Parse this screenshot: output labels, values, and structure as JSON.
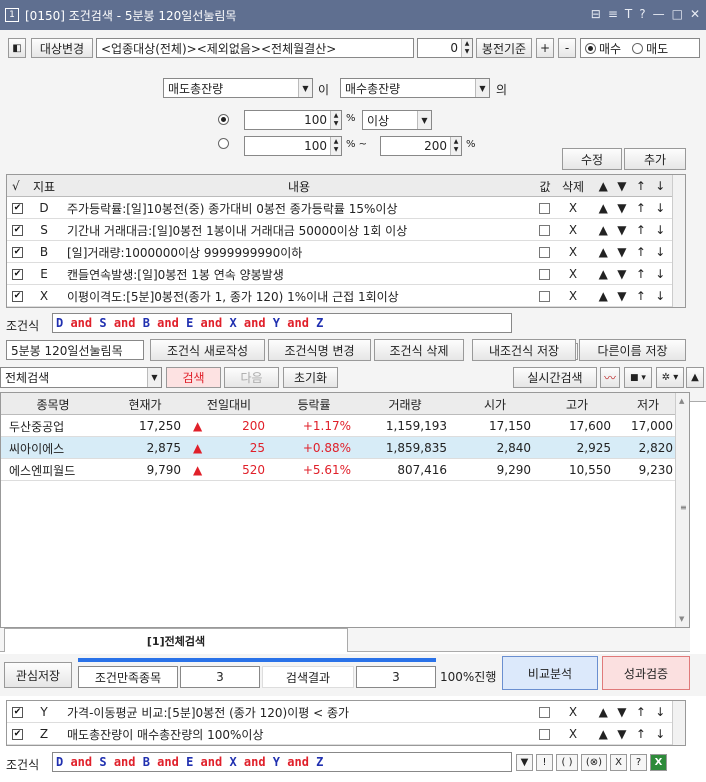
{
  "window": {
    "number": "1",
    "title": "[0150] 조건검색 - 5분봉 120일선눌림목",
    "controls": [
      "⊟",
      "≡",
      "T",
      "?",
      "—",
      "□",
      "✕"
    ]
  },
  "target": {
    "label": "대상변경",
    "value": "<업종대상(전체)><제외없음><전체월결산>",
    "bong_count": "0",
    "bong_label": "봉전기준",
    "plus": "+",
    "minus": "-",
    "buy_label": "매수",
    "sell_label": "매도"
  },
  "editor": {
    "left_select": "매도총잔량",
    "i_label": "이",
    "right_select": "매수총잔량",
    "ui_label": "의",
    "value1": "100",
    "pct1": "%",
    "cond1": "이상",
    "value2_from": "100",
    "pct2": "% ~",
    "value2_to": "200",
    "pct3": "%",
    "edit_button": "수정",
    "add_button": "추가"
  },
  "condition_table": {
    "headers": {
      "check": "√",
      "index": "지표",
      "content": "내용",
      "value": "값",
      "delete": "삭제"
    },
    "rows": [
      {
        "checked": true,
        "index": "D",
        "content": "주가등락률:[일]10봉전(중) 종가대비 0봉전 종가등락률 15%이상",
        "del": "X"
      },
      {
        "checked": true,
        "index": "S",
        "content": "기간내 거래대금:[일]0봉전 1봉이내 거래대금 50000이상 1회 이상",
        "del": "X"
      },
      {
        "checked": true,
        "index": "B",
        "content": "[일]거래량:1000000이상 9999999990이하",
        "del": "X"
      },
      {
        "checked": true,
        "index": "E",
        "content": "캔들연속발생:[일]0봉전 1봉 연속 양봉발생",
        "del": "X"
      },
      {
        "checked": true,
        "index": "X",
        "content": "이평이격도:[5분]0봉전(종가 1, 종가 120) 1%이내 근접 1회이상",
        "del": "X"
      }
    ],
    "move_icons": [
      "▲",
      "▼",
      "↑",
      "↓"
    ]
  },
  "formula": {
    "label": "조건식",
    "parts": [
      {
        "t": "D",
        "k": "v"
      },
      {
        "t": " and ",
        "k": "o"
      },
      {
        "t": "S",
        "k": "v"
      },
      {
        "t": " and ",
        "k": "o"
      },
      {
        "t": "B",
        "k": "v"
      },
      {
        "t": " and ",
        "k": "o"
      },
      {
        "t": "E",
        "k": "v"
      },
      {
        "t": " and ",
        "k": "o"
      },
      {
        "t": "X",
        "k": "v"
      },
      {
        "t": " and ",
        "k": "o"
      },
      {
        "t": "Y",
        "k": "v"
      },
      {
        "t": " and ",
        "k": "o"
      },
      {
        "t": "Z",
        "k": "v"
      }
    ],
    "buttons": [
      "▼",
      "!",
      "( )",
      "(⊗)",
      "X",
      "?"
    ]
  },
  "condition_name": {
    "value": "5분봉 120일선눌림목",
    "new_button": "조건식 새로작성",
    "rename_button": "조건식명 변경",
    "delete_button": "조건식 삭제",
    "save_button": "내조건식 저장",
    "save_as_button": "다른이름 저장"
  },
  "search": {
    "scope": "전체검색",
    "search_button": "검색",
    "next_button": "다음",
    "reset_button": "초기화",
    "realtime_button": "실시간검색"
  },
  "results": {
    "headers": [
      "종목명",
      "현재가",
      "전일대비",
      "등락률",
      "거래량",
      "시가",
      "고가",
      "저가"
    ],
    "rows": [
      {
        "name": "두산중공업",
        "price": "17,250",
        "arrow": "▲",
        "change": "200",
        "rate": "+1.17%",
        "volume": "1,159,193",
        "open": "17,150",
        "high": "17,600",
        "low": "17,000"
      },
      {
        "name": "씨아이에스",
        "price": "2,875",
        "arrow": "▲",
        "change": "25",
        "rate": "+0.88%",
        "volume": "1,859,835",
        "open": "2,840",
        "high": "2,925",
        "low": "2,820"
      },
      {
        "name": "에스엔피월드",
        "price": "9,790",
        "arrow": "▲",
        "change": "520",
        "rate": "+5.61%",
        "volume": "807,416",
        "open": "9,290",
        "high": "10,550",
        "low": "9,230"
      }
    ],
    "tab": "[1]전체검색"
  },
  "footer": {
    "watch_save": "관심저장",
    "match_label": "조건만족종목",
    "match_count": "3",
    "result_label": "검색결과",
    "result_count": "3",
    "progress_text": "100%진행",
    "progress": 1.0,
    "compare_button": "비교분석",
    "verify_button": "성과검증"
  },
  "lower_table": {
    "rows": [
      {
        "checked": true,
        "index": "Y",
        "content": "가격-이동평균 비교:[5분]0봉전 (종가 120)이평 < 종가",
        "del": "X"
      },
      {
        "checked": true,
        "index": "Z",
        "content": "매도총잔량이 매수총잔량의 100%이상",
        "del": "X"
      }
    ]
  },
  "colors": {
    "titlebar": "#5f6f90",
    "blue_text": "#2030b0",
    "red_text": "#e0202a",
    "highlight_row": "#d7ecf7",
    "compare_bg": "#dce9fb",
    "verify_bg": "#fbe0e0"
  }
}
